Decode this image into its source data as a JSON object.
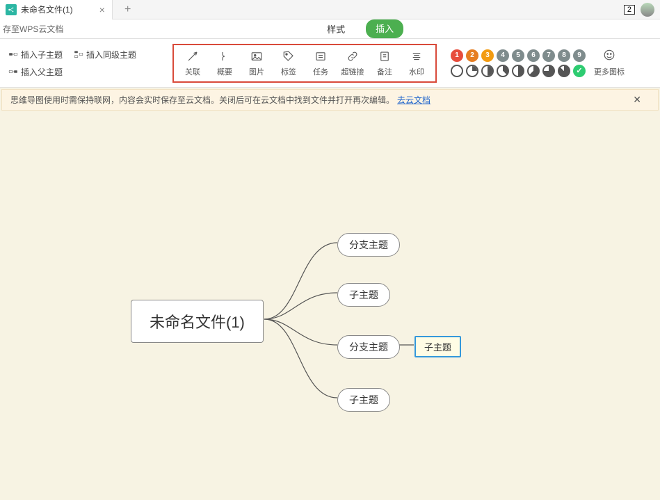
{
  "tab": {
    "title": "未命名文件(1)",
    "counter": "2"
  },
  "subbar": {
    "left_text": "存至WPS云文档",
    "style_tab": "样式",
    "insert_tab": "插入"
  },
  "sidebar": {
    "items": [
      {
        "label": "插入子主题"
      },
      {
        "label": "插入同级主题"
      },
      {
        "label": "插入父主题"
      }
    ]
  },
  "toolbar": {
    "items": [
      {
        "label": "关联"
      },
      {
        "label": "概要"
      },
      {
        "label": "图片"
      },
      {
        "label": "标签"
      },
      {
        "label": "任务"
      },
      {
        "label": "超链接"
      },
      {
        "label": "备注"
      },
      {
        "label": "水印"
      }
    ],
    "more_icons": "更多图标"
  },
  "markers": {
    "numbers": [
      "1",
      "2",
      "3",
      "4",
      "5",
      "6",
      "7",
      "8",
      "9"
    ]
  },
  "notice": {
    "text": "思维导图使用时需保持联网，内容会实时保存至云文档。关闭后可在云文档中找到文件并打开再次编辑。",
    "link": "去云文档"
  },
  "mindmap": {
    "root": "未命名文件(1)",
    "n1": "分支主题",
    "n2": "子主题",
    "n3": "分支主题",
    "n4": "子主题",
    "n3_1": "子主题"
  }
}
